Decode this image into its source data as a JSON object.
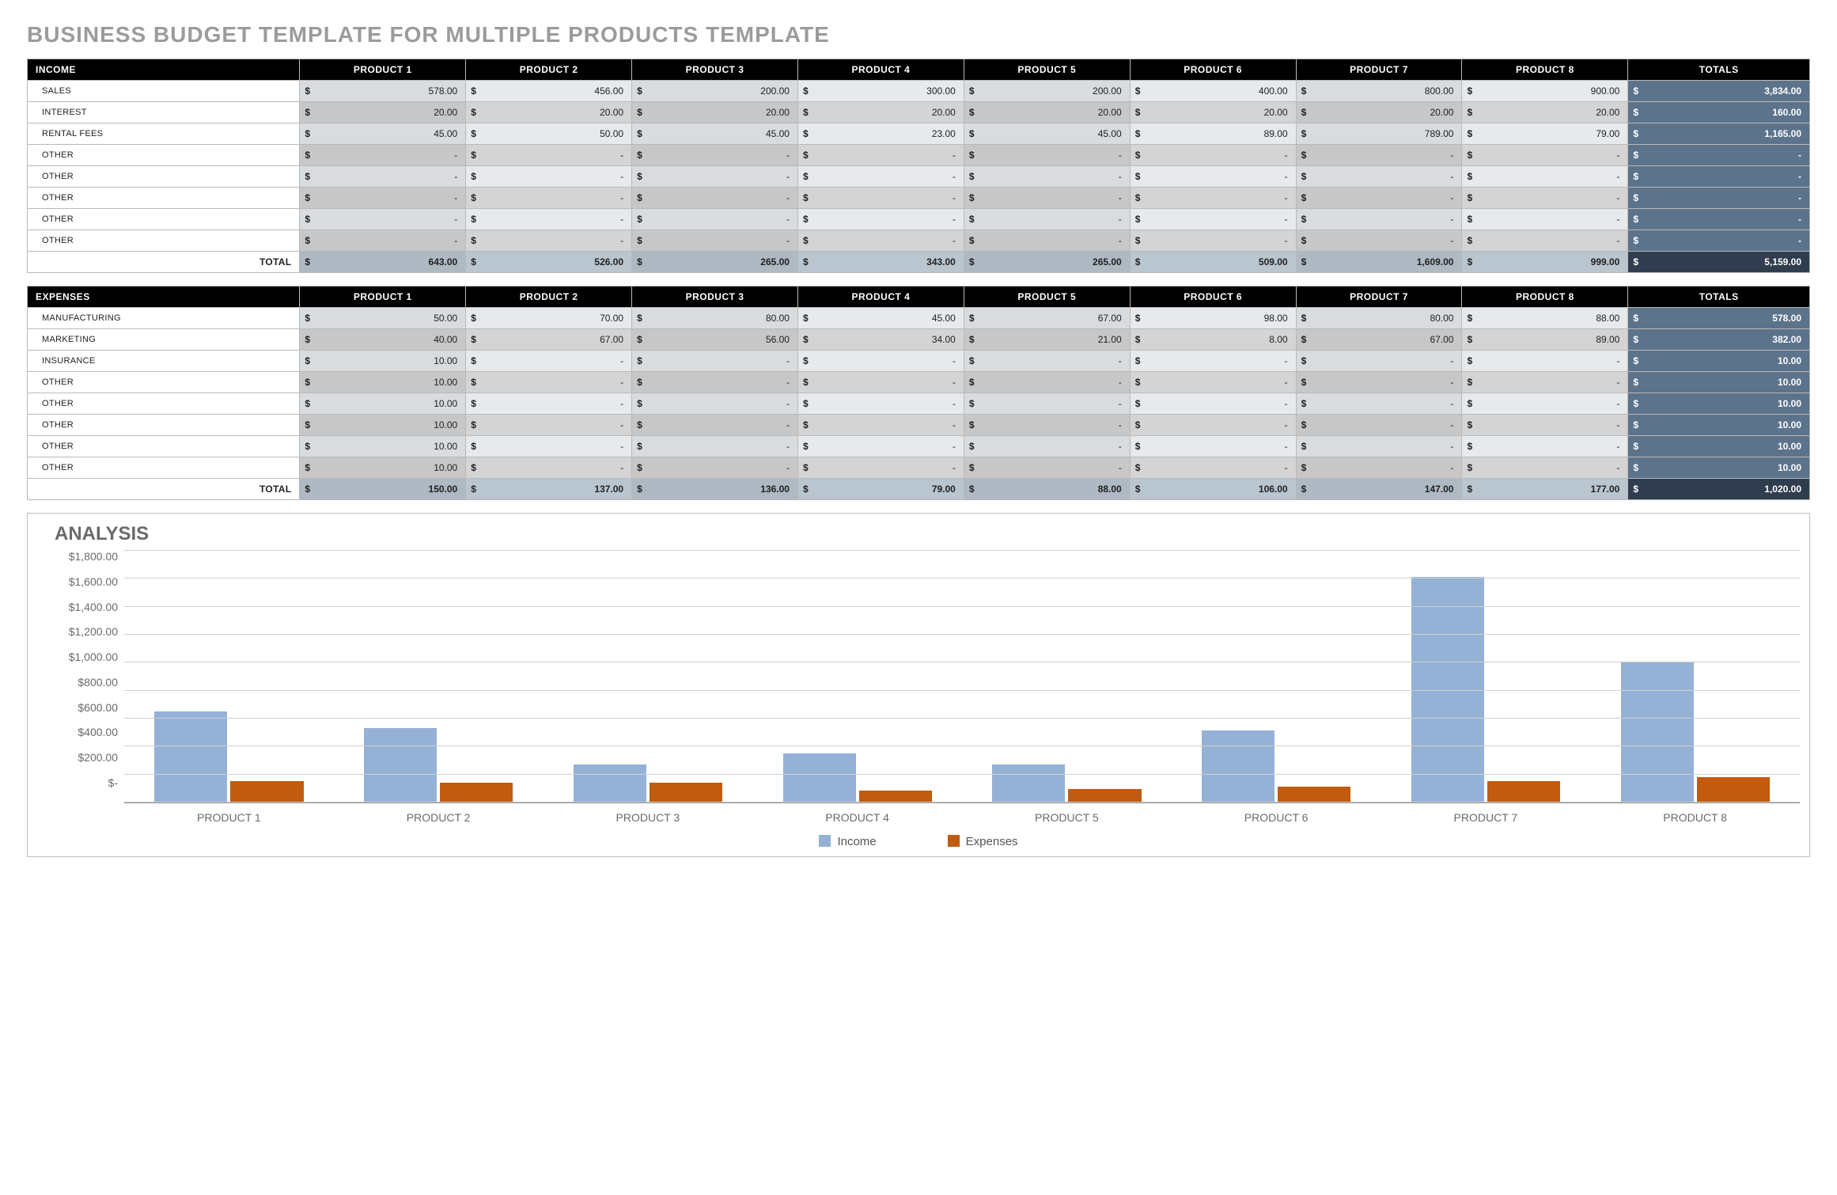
{
  "title": "BUSINESS BUDGET TEMPLATE FOR MULTIPLE PRODUCTS TEMPLATE",
  "currency": "$",
  "dash": "-",
  "products": [
    "PRODUCT 1",
    "PRODUCT 2",
    "PRODUCT 3",
    "PRODUCT 4",
    "PRODUCT 5",
    "PRODUCT 6",
    "PRODUCT 7",
    "PRODUCT 8"
  ],
  "totals_label": "TOTALS",
  "total_row_label": "TOTAL",
  "income": {
    "heading": "INCOME",
    "rows": [
      {
        "label": "SALES",
        "values": [
          "578.00",
          "456.00",
          "200.00",
          "300.00",
          "200.00",
          "400.00",
          "800.00",
          "900.00"
        ],
        "total": "3,834.00"
      },
      {
        "label": "INTEREST",
        "values": [
          "20.00",
          "20.00",
          "20.00",
          "20.00",
          "20.00",
          "20.00",
          "20.00",
          "20.00"
        ],
        "total": "160.00"
      },
      {
        "label": "RENTAL FEES",
        "values": [
          "45.00",
          "50.00",
          "45.00",
          "23.00",
          "45.00",
          "89.00",
          "789.00",
          "79.00"
        ],
        "total": "1,165.00"
      },
      {
        "label": "OTHER",
        "values": [
          "-",
          "-",
          "-",
          "-",
          "-",
          "-",
          "-",
          "-"
        ],
        "total": "-"
      },
      {
        "label": "OTHER",
        "values": [
          "-",
          "-",
          "-",
          "-",
          "-",
          "-",
          "-",
          "-"
        ],
        "total": "-"
      },
      {
        "label": "OTHER",
        "values": [
          "-",
          "-",
          "-",
          "-",
          "-",
          "-",
          "-",
          "-"
        ],
        "total": "-"
      },
      {
        "label": "OTHER",
        "values": [
          "-",
          "-",
          "-",
          "-",
          "-",
          "-",
          "-",
          "-"
        ],
        "total": "-"
      },
      {
        "label": "OTHER",
        "values": [
          "-",
          "-",
          "-",
          "-",
          "-",
          "-",
          "-",
          "-"
        ],
        "total": "-"
      }
    ],
    "totals": {
      "values": [
        "643.00",
        "526.00",
        "265.00",
        "343.00",
        "265.00",
        "509.00",
        "1,609.00",
        "999.00"
      ],
      "grand": "5,159.00"
    }
  },
  "expenses": {
    "heading": "EXPENSES",
    "rows": [
      {
        "label": "MANUFACTURING",
        "values": [
          "50.00",
          "70.00",
          "80.00",
          "45.00",
          "67.00",
          "98.00",
          "80.00",
          "88.00"
        ],
        "total": "578.00"
      },
      {
        "label": "MARKETING",
        "values": [
          "40.00",
          "67.00",
          "56.00",
          "34.00",
          "21.00",
          "8.00",
          "67.00",
          "89.00"
        ],
        "total": "382.00"
      },
      {
        "label": "INSURANCE",
        "values": [
          "10.00",
          "-",
          "-",
          "-",
          "-",
          "-",
          "-",
          "-"
        ],
        "total": "10.00"
      },
      {
        "label": "OTHER",
        "values": [
          "10.00",
          "-",
          "-",
          "-",
          "-",
          "-",
          "-",
          "-"
        ],
        "total": "10.00"
      },
      {
        "label": "OTHER",
        "values": [
          "10.00",
          "-",
          "-",
          "-",
          "-",
          "-",
          "-",
          "-"
        ],
        "total": "10.00"
      },
      {
        "label": "OTHER",
        "values": [
          "10.00",
          "-",
          "-",
          "-",
          "-",
          "-",
          "-",
          "-"
        ],
        "total": "10.00"
      },
      {
        "label": "OTHER",
        "values": [
          "10.00",
          "-",
          "-",
          "-",
          "-",
          "-",
          "-",
          "-"
        ],
        "total": "10.00"
      },
      {
        "label": "OTHER",
        "values": [
          "10.00",
          "-",
          "-",
          "-",
          "-",
          "-",
          "-",
          "-"
        ],
        "total": "10.00"
      }
    ],
    "totals": {
      "values": [
        "150.00",
        "137.00",
        "136.00",
        "79.00",
        "88.00",
        "106.00",
        "147.00",
        "177.00"
      ],
      "grand": "1,020.00"
    }
  },
  "chart_data": {
    "type": "bar",
    "title": "ANALYSIS",
    "categories": [
      "PRODUCT 1",
      "PRODUCT 2",
      "PRODUCT 3",
      "PRODUCT 4",
      "PRODUCT 5",
      "PRODUCT 6",
      "PRODUCT 7",
      "PRODUCT 8"
    ],
    "series": [
      {
        "name": "Income",
        "values": [
          643,
          526,
          265,
          343,
          265,
          509,
          1609,
          999
        ]
      },
      {
        "name": "Expenses",
        "values": [
          150,
          137,
          136,
          79,
          88,
          106,
          147,
          177
        ]
      }
    ],
    "y_ticks": [
      "$1,800.00",
      "$1,600.00",
      "$1,400.00",
      "$1,200.00",
      "$1,000.00",
      "$800.00",
      "$600.00",
      "$400.00",
      "$200.00",
      "$-"
    ],
    "ylim": [
      0,
      1800
    ],
    "xlabel": "",
    "ylabel": "",
    "legend": [
      "Income",
      "Expenses"
    ]
  }
}
